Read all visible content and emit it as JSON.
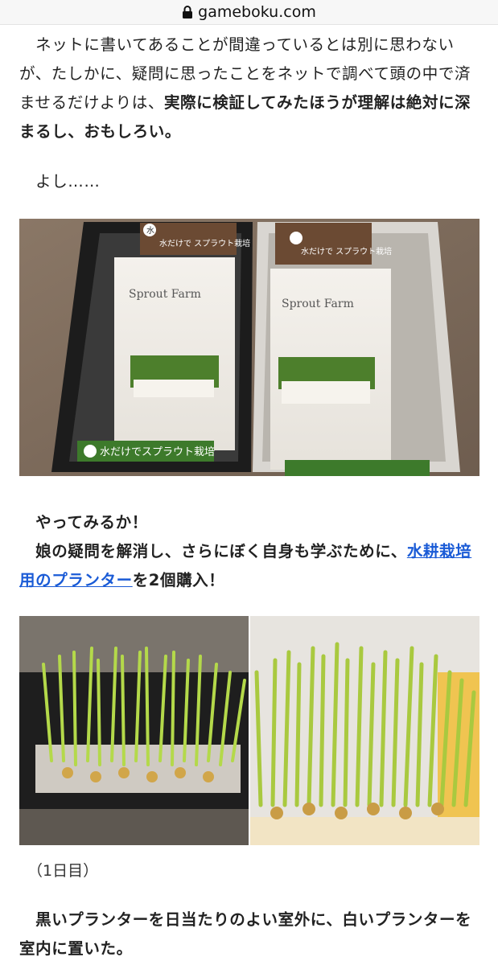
{
  "browser": {
    "url": "gameboku.com"
  },
  "article": {
    "p1": {
      "lead": "　ネットに書いてあることが間違っているとは別に思わないが、たしかに、疑問に思ったことをネットで調べて頭の中で済ませるだけよりは、",
      "bold": "実際に検証してみたほうが理解は絶対に深まるし、おもしろい。"
    },
    "p2": "　よし……",
    "photo1": {
      "package_label": "水だけで スプラウト栽培",
      "product_name": "Sprout Farm",
      "band_label": "水だけでスプラウト栽培"
    },
    "p3": {
      "line1": "　やってみるか！",
      "line2_lead": "　娘の疑問を解消し、さらにぼく自身も学ぶために、",
      "link": "水耕栽培用のプランター",
      "line2_tail": "を2個購入！"
    },
    "caption": "（1日目）",
    "p4": "　黒いプランターを日当たりのよい室外に、白いプランターを室内に置いた。"
  }
}
